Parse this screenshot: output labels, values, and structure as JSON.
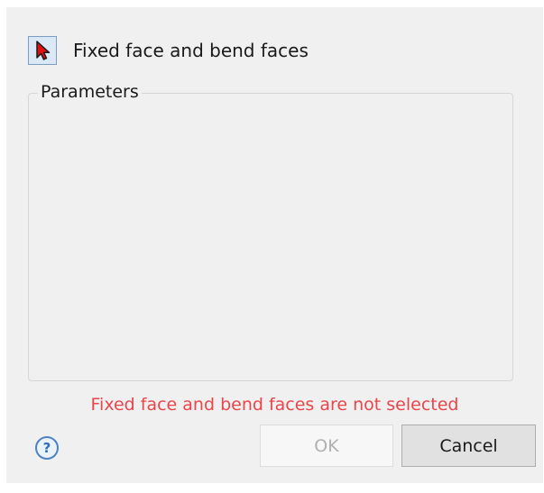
{
  "selector": {
    "icon": "red-arrow-cursor-icon",
    "label": "Fixed face and bend faces"
  },
  "parameters_group": {
    "legend": "Parameters"
  },
  "status": {
    "error_message": "Fixed face and bend faces are not selected",
    "error_color": "#e8464b"
  },
  "footer": {
    "help_icon": "question-mark-icon",
    "help_glyph": "?",
    "ok_label": "OK",
    "ok_enabled": false,
    "cancel_label": "Cancel"
  }
}
